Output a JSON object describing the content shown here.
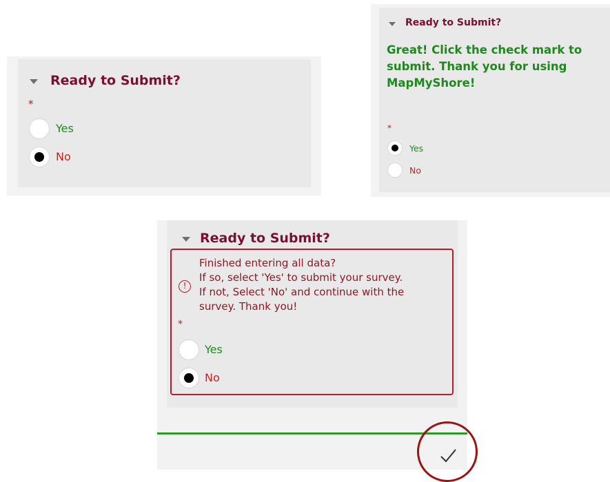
{
  "panel_a": {
    "title": "Ready to Submit?",
    "required_marker": "*",
    "options": [
      {
        "label": "Yes",
        "selected": false
      },
      {
        "label": "No",
        "selected": true
      }
    ]
  },
  "panel_b": {
    "title": "Ready to Submit?",
    "confirmation": "Great! Click the check mark to submit. Thank you for using MapMyShore!",
    "required_marker": "*",
    "options": [
      {
        "label": "Yes",
        "selected": true
      },
      {
        "label": "No",
        "selected": false
      }
    ]
  },
  "panel_c": {
    "title": "Ready to Submit?",
    "warning_lines": [
      "Finished entering all data?",
      "If so, select 'Yes' to submit your survey.",
      "If not, Select 'No' and continue with the",
      "survey. Thank you!"
    ],
    "warning_icon": "exclamation-circle-icon",
    "required_marker": "*",
    "options": [
      {
        "label": "Yes",
        "selected": false
      },
      {
        "label": "No",
        "selected": true
      }
    ],
    "submit_icon": "checkmark-icon"
  },
  "colors": {
    "title": "#7a1030",
    "yes_text": "#1e8a1e",
    "no_text": "#c81e1e",
    "panel_background": "#e9e9e9",
    "warning_border": "#b51c2c",
    "highlight_circle": "#9a1414",
    "footer_rule": "#2e9a2e"
  }
}
